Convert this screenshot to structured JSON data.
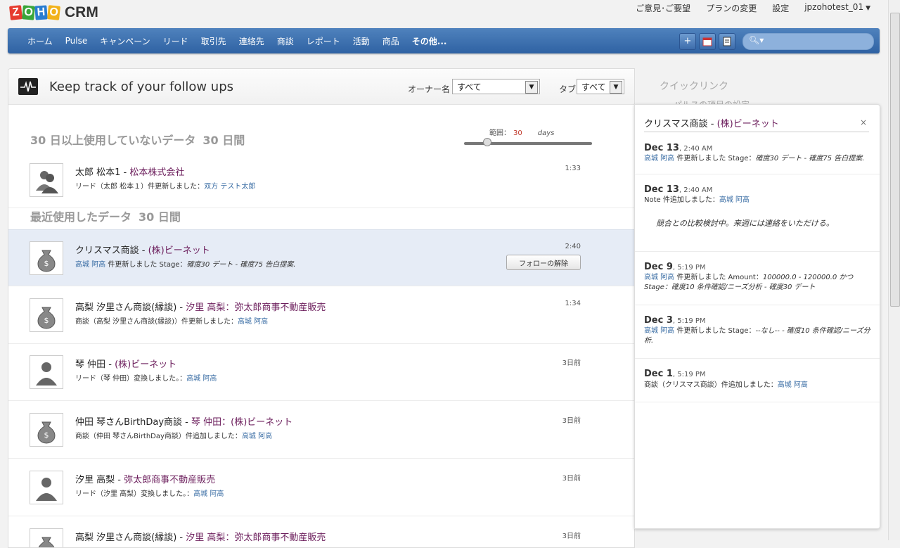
{
  "app": {
    "logo_letters": [
      "Z",
      "O",
      "H",
      "O"
    ],
    "product": "CRM"
  },
  "toplinks": {
    "feedback": "ご意見･ご要望",
    "plan": "プランの変更",
    "settings": "設定",
    "user": "jpzohotest_01"
  },
  "nav": {
    "tabs": [
      "ホーム",
      "Pulse",
      "キャンペーン",
      "リード",
      "取引先",
      "連絡先",
      "商談",
      "レポート",
      "活動",
      "商品",
      "その他..."
    ],
    "search_placeholder": ""
  },
  "pulse": {
    "title": "Keep track of your follow ups",
    "owner_label": "オーナー名",
    "owner_value": "すべて",
    "tab_label": "タブ",
    "tab_value": "すべて",
    "section_inactive": "30 日以上使用していないデータ",
    "section_inactive_days": "30 日間",
    "range_label": "範囲：",
    "range_value": "30",
    "range_unit": "days",
    "range_fraction": 0.18,
    "section_recent": "最近使用したデータ",
    "section_recent_days": "30 日間",
    "unfollow_label": "フォローの解除",
    "inactive_rows": [
      {
        "name": "太郎 松本1",
        "sep": " - ",
        "rel": "松本株式会社",
        "sub_pre": "リード（太郎 松本１）件更新しました：",
        "sub_user": "双方 テスト太郎",
        "sub_post": "",
        "time": "1:33"
      }
    ],
    "recent_rows": [
      {
        "name": "クリスマス商談",
        "sep": " - ",
        "rel": "(株)ビーネット",
        "sub_user": "高城 阿高",
        "sub_pre": " 件更新しました Stage：",
        "sub_post": "確度30 デート - 確度75 告白提案.",
        "time": "2:40"
      },
      {
        "name": "高梨 汐里さん商談(縁談)",
        "sep": " - ",
        "rel": "汐里 高梨：弥太郎商事不動産販売",
        "sub_pre": "商談（高梨 汐里さん商談(縁談)）件更新しました：",
        "sub_user": "高城 阿高",
        "sub_post": "",
        "time": "1:34"
      },
      {
        "name": "琴 仲田",
        "sep": " - ",
        "rel": "(株)ビーネット",
        "sub_pre": "リード（琴 仲田）変換しました。：",
        "sub_user": "高城 阿高",
        "sub_post": "",
        "time": "3日前"
      },
      {
        "name": "仲田 琴さんBirthDay商談",
        "sep": " - ",
        "rel": "琴 仲田：(株)ビーネット",
        "sub_pre": "商談（仲田 琴さんBirthDay商談）件追加しました：",
        "sub_user": "高城 阿高",
        "sub_post": "",
        "time": "3日前"
      },
      {
        "name": "汐里 高梨",
        "sep": " - ",
        "rel": "弥太郎商事不動産販売",
        "sub_pre": "リード（汐里 高梨）変換しました。：",
        "sub_user": "高城 阿高",
        "sub_post": "",
        "time": "3日前"
      },
      {
        "name": "高梨 汐里さん商談(縁談)",
        "sep": " - ",
        "rel": "汐里 高梨：弥太郎商事不動産販売",
        "sub_pre": "",
        "sub_user": "",
        "sub_post": "",
        "time": "3日前"
      }
    ]
  },
  "quicklinks": {
    "title": "クイックリンク",
    "item": "パルスの項目の設定"
  },
  "side": {
    "title_name": "クリスマス商談",
    "title_sep": " - ",
    "title_rel": "(株)ビーネット",
    "close": "×",
    "activities": [
      {
        "date": "Dec 13",
        "time": ", 2:40 AM",
        "user": "高城 阿高",
        "pre": "",
        "mid": " 件更新しました Stage：",
        "ital": "確度30 デート - 確度75 告白提案.",
        "note": ""
      },
      {
        "date": "Dec 13",
        "time": ", 2:40 AM",
        "user": "高城 阿高",
        "pre": "Note 件追加しました：",
        "mid": "",
        "ital": "",
        "note": "競合との比較検討中。来週には連絡をいただける。"
      },
      {
        "date": "Dec 9",
        "time": ", 5:19 PM",
        "user": "高城 阿高",
        "pre": "",
        "mid": " 件更新しました Amount：",
        "ital": "100000.0 - 120000.0 かつ Stage：確度10 条件確認/ニーズ分析 - 確度30 デート",
        "note": ""
      },
      {
        "date": "Dec 3",
        "time": ", 5:19 PM",
        "user": "高城 阿高",
        "pre": "",
        "mid": " 件更新しました Stage：",
        "ital": "--なし-- - 確度10 条件確認/ニーズ分析.",
        "note": ""
      },
      {
        "date": "Dec 1",
        "time": ", 5:19 PM",
        "user": "高城 阿高",
        "pre": "商談（クリスマス商談）件追加しました：",
        "mid": "",
        "ital": "",
        "note": ""
      }
    ]
  }
}
